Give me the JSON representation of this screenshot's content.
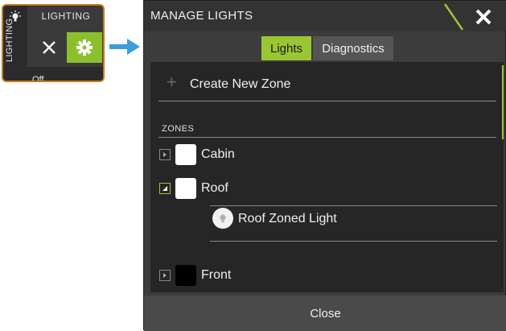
{
  "widget": {
    "side_label": "LIGHTING",
    "title": "LIGHTING",
    "status": "Off",
    "colors": {
      "border": "#c77a1e",
      "settings_bg": "#8cbf2e"
    }
  },
  "dialog": {
    "title": "MANAGE LIGHTS",
    "tabs": [
      {
        "label": "Lights",
        "active": true
      },
      {
        "label": "Diagnostics",
        "active": false
      }
    ],
    "create_zone_label": "Create New Zone",
    "zones_header": "ZONES",
    "zones": [
      {
        "label": "Cabin",
        "expanded": false,
        "swatch": "#ffffff"
      },
      {
        "label": "Roof",
        "expanded": true,
        "swatch": "#ffffff"
      },
      {
        "label": "Front",
        "expanded": false,
        "swatch": "#000000"
      }
    ],
    "roof_light": {
      "label": "Roof Zoned Light",
      "icon": "bulb-icon"
    },
    "close_label": "Close",
    "accent": "#9bc634"
  }
}
